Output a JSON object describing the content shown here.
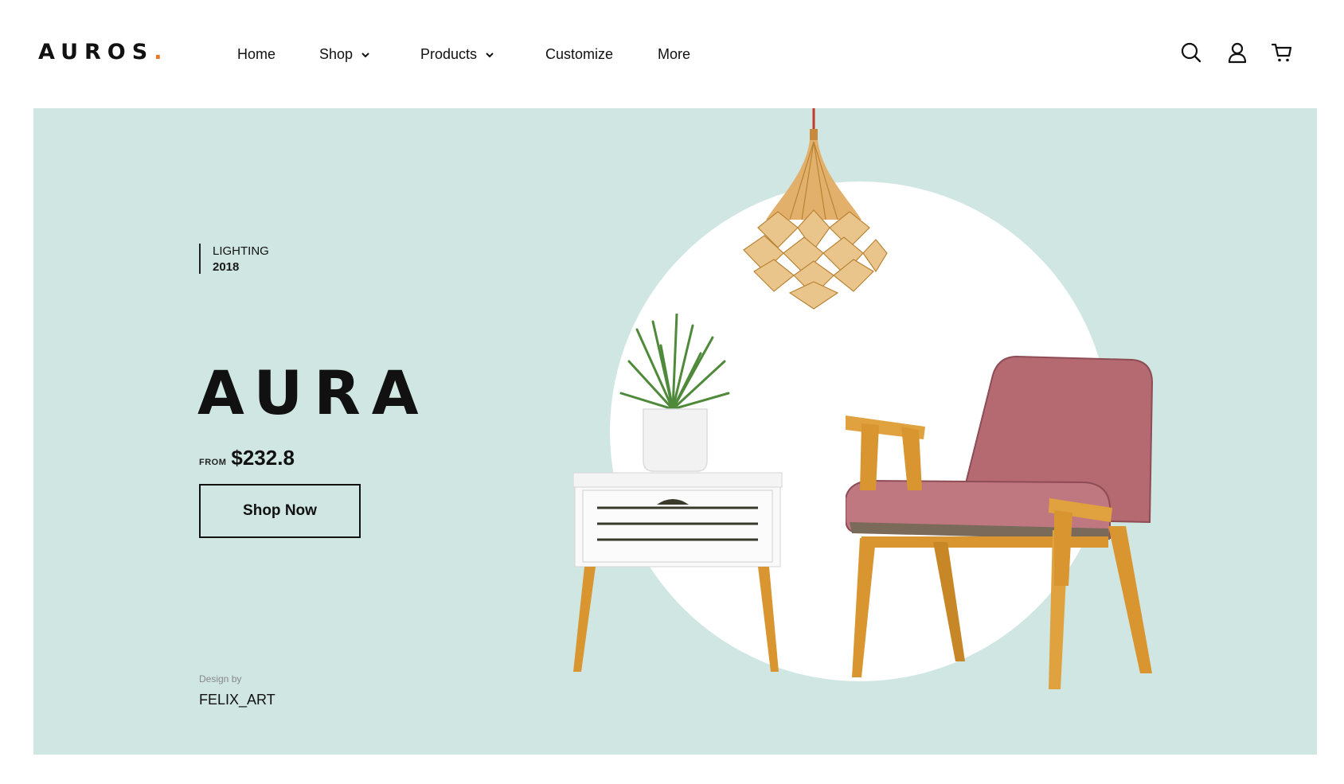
{
  "brand": {
    "name": "AUROS",
    "dot": "."
  },
  "nav": {
    "home": "Home",
    "shop": "Shop",
    "products": "Products",
    "customize": "Customize",
    "more": "More"
  },
  "header_icons": [
    "search-icon",
    "user-icon",
    "cart-icon"
  ],
  "hero": {
    "tag_line1": "LIGHTING",
    "tag_line2": "2018",
    "title": "AURA",
    "price_prefix": "FROM",
    "price": "$232.8",
    "cta": "Shop Now",
    "design_by_label": "Design by",
    "designer": "FELIX_ART"
  },
  "colors": {
    "hero_bg": "#cfe6e2",
    "accent": "#e8792b",
    "chair": "#b56a72",
    "wood": "#d9952f"
  }
}
